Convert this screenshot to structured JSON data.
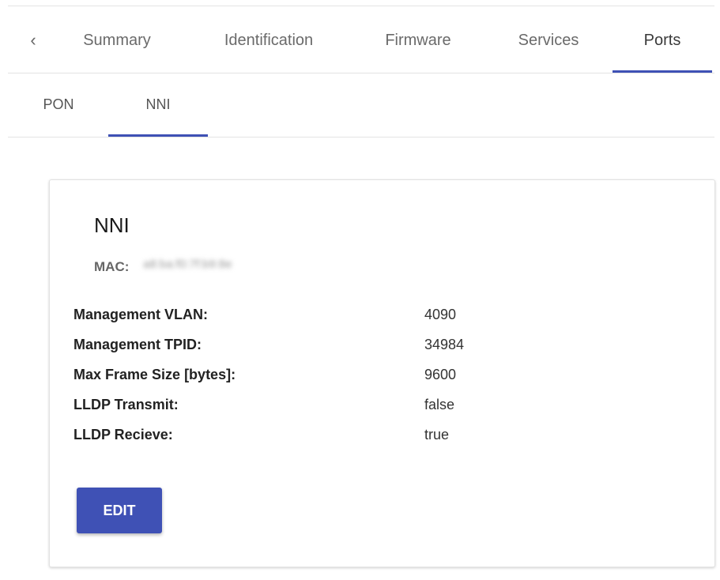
{
  "tabs": {
    "back_icon": "chevron-left-icon",
    "items": [
      {
        "label": "Summary"
      },
      {
        "label": "Identification"
      },
      {
        "label": "Firmware"
      },
      {
        "label": "Services"
      },
      {
        "label": "Ports",
        "active": true
      }
    ]
  },
  "subtabs": {
    "items": [
      {
        "label": "PON"
      },
      {
        "label": "NNI",
        "active": true
      }
    ]
  },
  "card": {
    "title": "NNI",
    "mac_label": "MAC:",
    "mac_value": "a8:ba:f0:7f:b9:8e",
    "properties": [
      {
        "label": "Management VLAN:",
        "value": "4090"
      },
      {
        "label": "Management TPID:",
        "value": "34984"
      },
      {
        "label": "Max Frame Size [bytes]:",
        "value": "9600"
      },
      {
        "label": "LLDP Transmit:",
        "value": "false"
      },
      {
        "label": "LLDP Recieve:",
        "value": "true"
      }
    ],
    "edit_label": "EDIT"
  },
  "colors": {
    "accent": "#3f51b5"
  }
}
